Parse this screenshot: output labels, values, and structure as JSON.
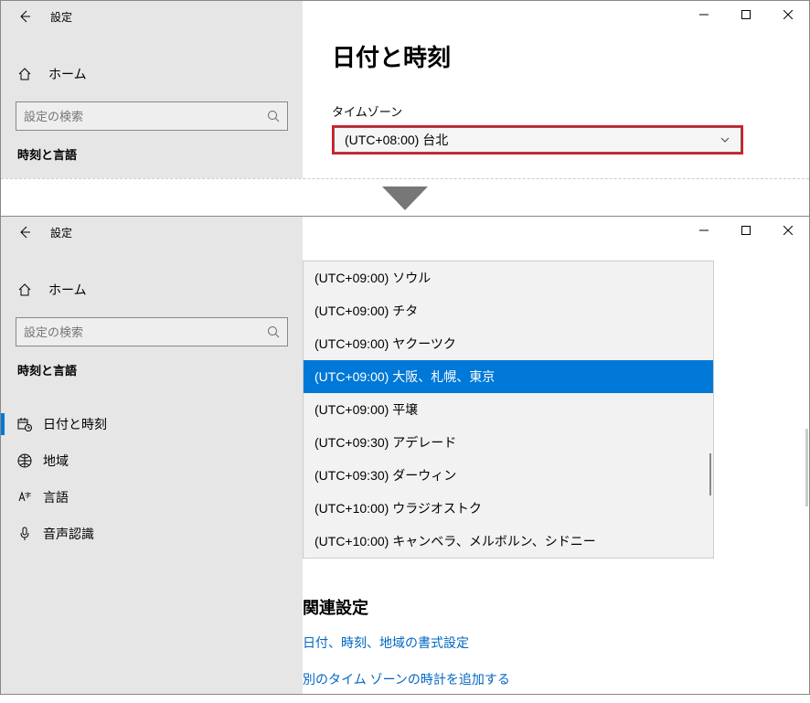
{
  "shared": {
    "app_title": "設定",
    "home_label": "ホーム",
    "search_placeholder": "設定の検索",
    "category_label": "時刻と言語"
  },
  "window1": {
    "page_title": "日付と時刻",
    "timezone_label": "タイムゾーン",
    "timezone_value": "(UTC+08:00) 台北"
  },
  "window2": {
    "sidebar_items": [
      {
        "label": "日付と時刻",
        "selected": true
      },
      {
        "label": "地域",
        "selected": false
      },
      {
        "label": "言語",
        "selected": false
      },
      {
        "label": "音声認識",
        "selected": false
      }
    ],
    "dropdown_items": [
      {
        "label": "(UTC+09:00) ソウル"
      },
      {
        "label": "(UTC+09:00) チタ"
      },
      {
        "label": "(UTC+09:00) ヤクーツク"
      },
      {
        "label": "(UTC+09:00) 大阪、札幌、東京",
        "selected": true
      },
      {
        "label": "(UTC+09:00) 平壌"
      },
      {
        "label": "(UTC+09:30) アデレード"
      },
      {
        "label": "(UTC+09:30) ダーウィン"
      },
      {
        "label": "(UTC+10:00) ウラジオストク"
      },
      {
        "label": "(UTC+10:00) キャンベラ、メルボルン、シドニー"
      }
    ],
    "related_heading": "関連設定",
    "link1": "日付、時刻、地域の書式設定",
    "link2": "別のタイム ゾーンの時計を追加する"
  }
}
